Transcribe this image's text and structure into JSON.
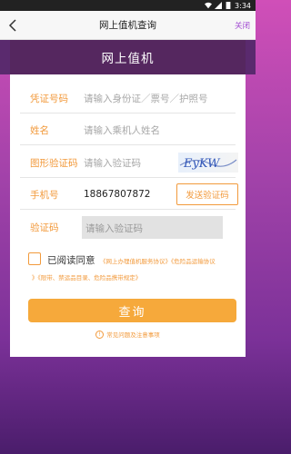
{
  "status_bar": {
    "time": "3:34"
  },
  "nav": {
    "title": "网上值机查询",
    "close_label": "关闭"
  },
  "card": {
    "title": "网上值机"
  },
  "form": {
    "id_label": "凭证号码",
    "id_placeholder": "请输入身份证／票号／护照号",
    "name_label": "姓名",
    "name_placeholder": "请输入乘机人姓名",
    "captcha_label": "图形验证码",
    "captcha_placeholder": "请输入验证码",
    "captcha_text": "EyKW",
    "phone_label": "手机号",
    "phone_value": "18867807872",
    "send_code_label": "发送验证码",
    "code_label": "验证码",
    "code_placeholder": "请输入验证码"
  },
  "agreement": {
    "label": "已阅读同意",
    "links_line1": "《网上办理值机服务协议》《危险品运输协议",
    "links_line2": "》《限带、禁运品目录、危险品携带规定》"
  },
  "query_label": "查询",
  "faq_label": "常见问题及注意事项",
  "colors": {
    "accent": "#f29a3c",
    "header": "#55275f",
    "close": "#a14bd2"
  }
}
